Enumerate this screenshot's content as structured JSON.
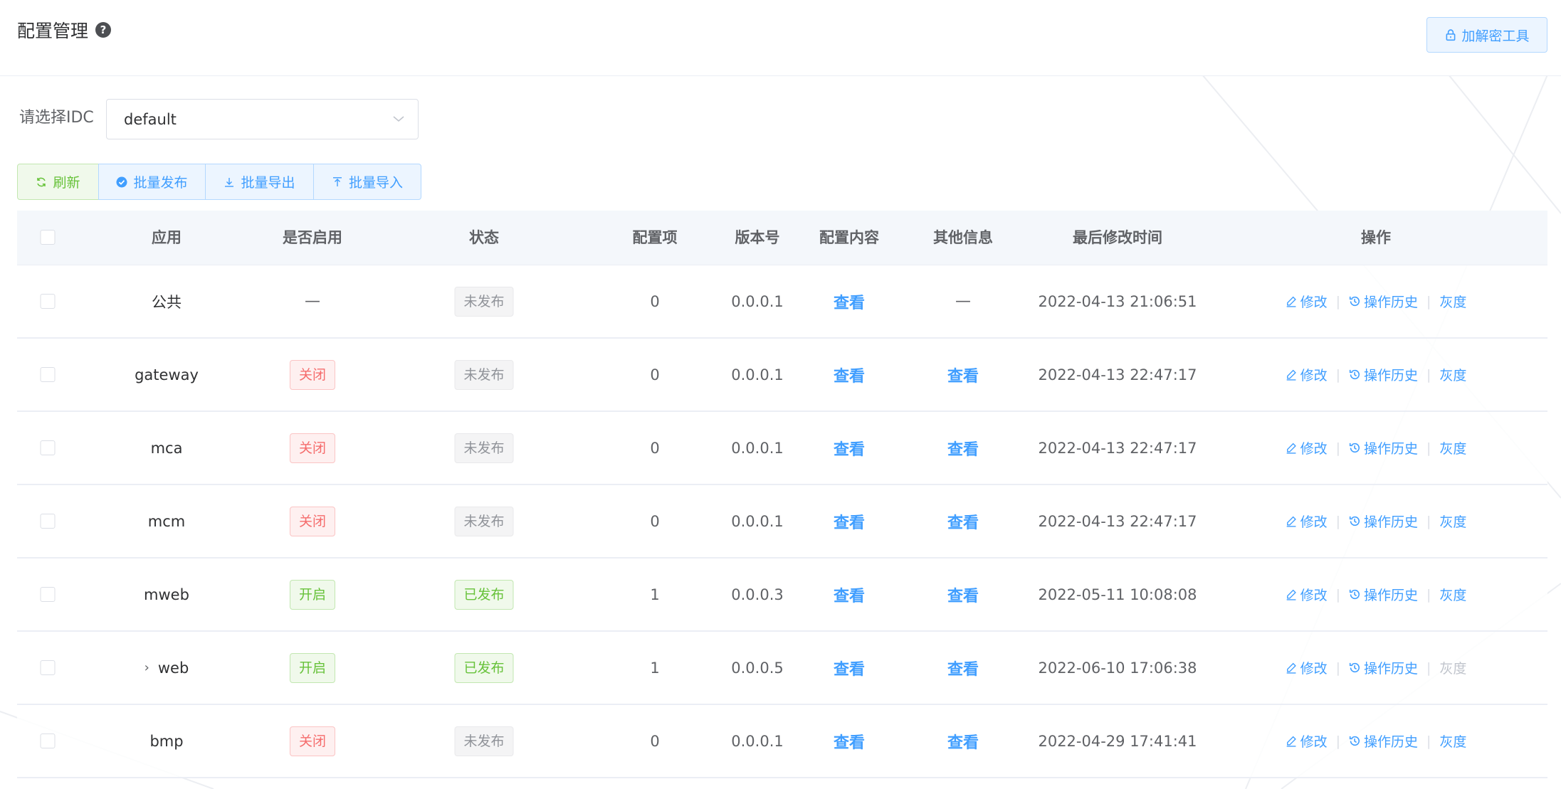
{
  "header": {
    "title": "配置管理",
    "help_icon": "question-circle-icon",
    "crypto_tool_label": "加解密工具",
    "crypto_tool_icon": "lock-icon"
  },
  "idc": {
    "label": "请选择IDC",
    "selected": "default"
  },
  "toolbar": {
    "refresh_label": "刷新",
    "batch_publish_label": "批量发布",
    "batch_export_label": "批量导出",
    "batch_import_label": "批量导入"
  },
  "table": {
    "headers": {
      "app": "应用",
      "enabled": "是否启用",
      "status": "状态",
      "config_items": "配置项",
      "version": "版本号",
      "config_content": "配置内容",
      "other_info": "其他信息",
      "last_modified": "最后修改时间",
      "actions": "操作"
    },
    "action_labels": {
      "edit": "修改",
      "history": "操作历史",
      "gray": "灰度"
    },
    "rows": [
      {
        "app": "公共",
        "enabled": "—",
        "enabled_type": "none",
        "status": "未发布",
        "status_type": "info",
        "config_items": "0",
        "version": "0.0.0.1",
        "config_content": "查看",
        "other_info": "—",
        "last_modified": "2022-04-13 21:06:51",
        "expandable": false,
        "gray_disabled": false
      },
      {
        "app": "gateway",
        "enabled": "关闭",
        "enabled_type": "danger",
        "status": "未发布",
        "status_type": "info",
        "config_items": "0",
        "version": "0.0.0.1",
        "config_content": "查看",
        "other_info": "查看",
        "last_modified": "2022-04-13 22:47:17",
        "expandable": false,
        "gray_disabled": false
      },
      {
        "app": "mca",
        "enabled": "关闭",
        "enabled_type": "danger",
        "status": "未发布",
        "status_type": "info",
        "config_items": "0",
        "version": "0.0.0.1",
        "config_content": "查看",
        "other_info": "查看",
        "last_modified": "2022-04-13 22:47:17",
        "expandable": false,
        "gray_disabled": false
      },
      {
        "app": "mcm",
        "enabled": "关闭",
        "enabled_type": "danger",
        "status": "未发布",
        "status_type": "info",
        "config_items": "0",
        "version": "0.0.0.1",
        "config_content": "查看",
        "other_info": "查看",
        "last_modified": "2022-04-13 22:47:17",
        "expandable": false,
        "gray_disabled": false
      },
      {
        "app": "mweb",
        "enabled": "开启",
        "enabled_type": "success",
        "status": "已发布",
        "status_type": "success",
        "config_items": "1",
        "version": "0.0.0.3",
        "config_content": "查看",
        "other_info": "查看",
        "last_modified": "2022-05-11 10:08:08",
        "expandable": false,
        "gray_disabled": false
      },
      {
        "app": "web",
        "enabled": "开启",
        "enabled_type": "success",
        "status": "已发布",
        "status_type": "success",
        "config_items": "1",
        "version": "0.0.0.5",
        "config_content": "查看",
        "other_info": "查看",
        "last_modified": "2022-06-10 17:06:38",
        "expandable": true,
        "gray_disabled": true
      },
      {
        "app": "bmp",
        "enabled": "关闭",
        "enabled_type": "danger",
        "status": "未发布",
        "status_type": "info",
        "config_items": "0",
        "version": "0.0.0.1",
        "config_content": "查看",
        "other_info": "查看",
        "last_modified": "2022-04-29 17:41:41",
        "expandable": false,
        "gray_disabled": false
      }
    ]
  },
  "colors": {
    "primary": "#409eff",
    "success": "#67c23a",
    "danger": "#f56c6c",
    "info": "#909399",
    "header_bg": "#f4f7fb"
  }
}
